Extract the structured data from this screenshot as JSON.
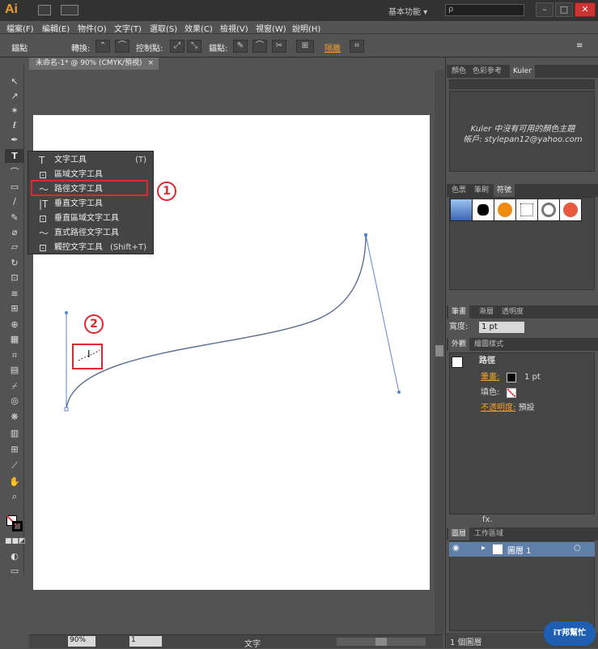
{
  "app": {
    "logo": "Ai",
    "workspace": "基本功能",
    "workspace_arrow": "▾",
    "search_placeholder": "ρ"
  },
  "menu": [
    "檔案(F)",
    "編輯(E)",
    "物件(O)",
    "文字(T)",
    "選取(S)",
    "效果(C)",
    "檢視(V)",
    "視窗(W)",
    "說明(H)"
  ],
  "control": {
    "selection": "錨點",
    "convert": "轉換:",
    "handles": "控制點:",
    "anchors": "錨點:",
    "isolate": "隔離"
  },
  "doc_tab": {
    "title": "未命名-1* @ 90% (CMYK/預視)",
    "close": "×"
  },
  "flyout": {
    "items": [
      {
        "icon": "T",
        "label": "文字工具",
        "shortcut": "(T)"
      },
      {
        "icon": "⊡",
        "label": "區域文字工具",
        "shortcut": ""
      },
      {
        "icon": "〜",
        "label": "路徑文字工具",
        "shortcut": ""
      },
      {
        "icon": "|T",
        "label": "垂直文字工具",
        "shortcut": ""
      },
      {
        "icon": "⊡",
        "label": "垂直區域文字工具",
        "shortcut": ""
      },
      {
        "icon": "〜",
        "label": "直式路徑文字工具",
        "shortcut": ""
      },
      {
        "icon": "⊡",
        "label": "觸控文字工具",
        "shortcut": "(Shift+T)"
      }
    ]
  },
  "steps": {
    "one": "1",
    "two": "2"
  },
  "status": {
    "zoom": "90%",
    "page": "1",
    "tool": "文字"
  },
  "kuler": {
    "tabs": [
      "顏色",
      "色彩參考",
      "Kuler"
    ],
    "msg1": "Kuler 中沒有可用的顏色主題",
    "msg2": "帳戶: stylepan12@yahoo.com"
  },
  "swatch_tabs": [
    "色票",
    "筆刷",
    "符號"
  ],
  "symbols_label": "",
  "stroke": {
    "tabs": [
      "筆畫",
      "漸層",
      "透明度"
    ],
    "weight_label": "寬度:",
    "weight_value": "1 pt"
  },
  "appearance": {
    "tabs": [
      "外觀",
      "繪圖樣式"
    ],
    "title": "路徑",
    "stroke_label": "筆畫:",
    "stroke_value": "1 pt",
    "fill_label": "填色:",
    "opacity_label": "不透明度:",
    "opacity_value": "預設",
    "fx": "fx."
  },
  "layers": {
    "tabs": [
      "圖層",
      "工作區域"
    ],
    "layer_name": "圖層 1",
    "count": "1 個圖層"
  },
  "badge": "iT邦幫忙",
  "colors": {
    "accent_red": "#e0262e",
    "path_blue": "#5b86d6",
    "layer_blue": "#5d7fa8"
  }
}
